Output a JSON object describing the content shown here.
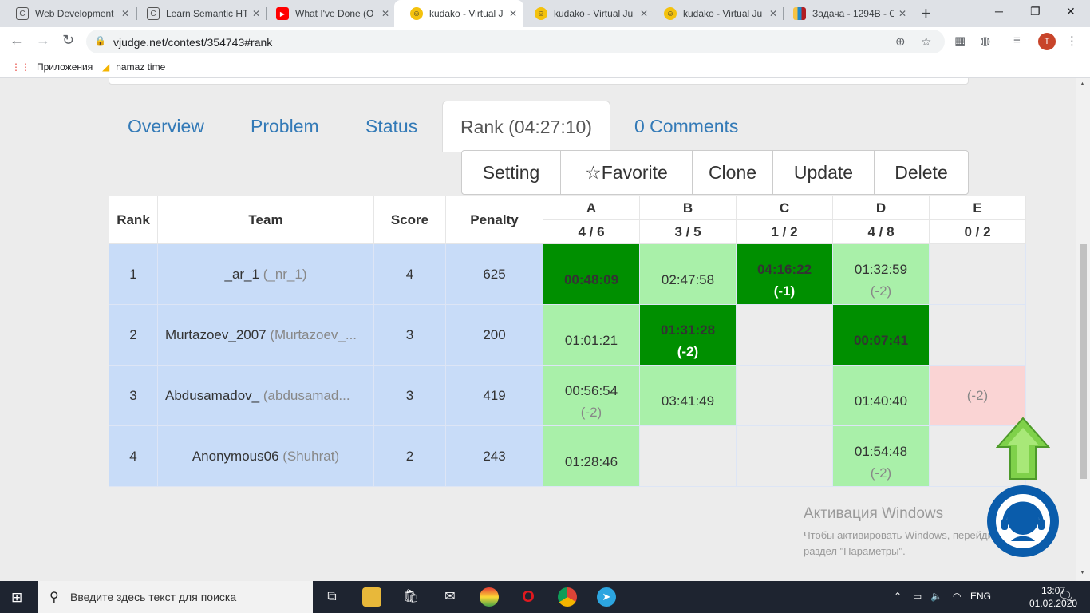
{
  "browser": {
    "tabs": [
      {
        "title": "Web Development",
        "icon": "c-icon",
        "active": false
      },
      {
        "title": "Learn Semantic HT",
        "icon": "c-icon",
        "active": false
      },
      {
        "title": "What I've Done (O",
        "icon": "youtube-icon",
        "active": false
      },
      {
        "title": "kudako - Virtual Ju",
        "icon": "vjudge-icon",
        "active": true
      },
      {
        "title": "kudako - Virtual Ju",
        "icon": "vjudge-icon",
        "active": false
      },
      {
        "title": "kudako - Virtual Ju",
        "icon": "vjudge-icon",
        "active": false
      },
      {
        "title": "Задача - 1294B - C",
        "icon": "codeforces-icon",
        "active": false
      }
    ],
    "url": "vjudge.net/contest/354743#rank",
    "avatar_letter": "T",
    "bookmarks": [
      {
        "label": "Приложения",
        "icon": "apps-grid-icon"
      },
      {
        "label": "namaz time",
        "icon": "drive-icon"
      }
    ]
  },
  "contest": {
    "nav_tabs": [
      {
        "label": "Overview",
        "active": false
      },
      {
        "label": "Problem",
        "active": false
      },
      {
        "label": "Status",
        "active": false
      },
      {
        "label": "Rank (04:27:10)",
        "active": true
      },
      {
        "label": "0 Comments",
        "active": false
      }
    ],
    "actions": {
      "setting": "Setting",
      "favorite": "☆Favorite",
      "clone": "Clone",
      "update": "Update",
      "delete": "Delete"
    },
    "rank_table": {
      "headers": {
        "rank": "Rank",
        "team": "Team",
        "score": "Score",
        "penalty": "Penalty"
      },
      "problems": [
        {
          "letter": "A",
          "ratio": "4 / 6"
        },
        {
          "letter": "B",
          "ratio": "3 / 5"
        },
        {
          "letter": "C",
          "ratio": "1 / 2"
        },
        {
          "letter": "D",
          "ratio": "4 / 8"
        },
        {
          "letter": "E",
          "ratio": "0 / 2"
        }
      ],
      "rows": [
        {
          "rank": "1",
          "team": "_ar_1",
          "nick": "(_nr_1)",
          "align": "center",
          "score": "4",
          "penalty": "625",
          "cells": [
            {
              "state": "first",
              "time": "00:48:09",
              "extra": ""
            },
            {
              "state": "ok",
              "time": "02:47:58",
              "extra": ""
            },
            {
              "state": "first",
              "time": "04:16:22",
              "extra": "(-1)"
            },
            {
              "state": "ok",
              "time": "01:32:59",
              "extra": "(-2)"
            },
            {
              "state": "empty",
              "time": "",
              "extra": ""
            }
          ]
        },
        {
          "rank": "2",
          "team": "Murtazoev_2007",
          "nick": "(Murtazoev_...",
          "align": "left",
          "score": "3",
          "penalty": "200",
          "cells": [
            {
              "state": "ok",
              "time": "01:01:21",
              "extra": ""
            },
            {
              "state": "first",
              "time": "01:31:28",
              "extra": "(-2)"
            },
            {
              "state": "empty",
              "time": "",
              "extra": ""
            },
            {
              "state": "first",
              "time": "00:07:41",
              "extra": ""
            },
            {
              "state": "empty",
              "time": "",
              "extra": ""
            }
          ]
        },
        {
          "rank": "3",
          "team": "Abdusamadov_",
          "nick": "(abdusamad...",
          "align": "left",
          "score": "3",
          "penalty": "419",
          "cells": [
            {
              "state": "ok",
              "time": "00:56:54",
              "extra": "(-2)"
            },
            {
              "state": "ok",
              "time": "03:41:49",
              "extra": ""
            },
            {
              "state": "empty",
              "time": "",
              "extra": ""
            },
            {
              "state": "ok",
              "time": "01:40:40",
              "extra": ""
            },
            {
              "state": "fail",
              "time": "",
              "extra": "(-2)"
            }
          ]
        },
        {
          "rank": "4",
          "team": "Anonymous06",
          "nick": "(Shuhrat)",
          "align": "center",
          "score": "2",
          "penalty": "243",
          "cells": [
            {
              "state": "ok",
              "time": "01:28:46",
              "extra": ""
            },
            {
              "state": "empty",
              "time": "",
              "extra": ""
            },
            {
              "state": "empty",
              "time": "",
              "extra": ""
            },
            {
              "state": "ok",
              "time": "01:54:48",
              "extra": "(-2)"
            },
            {
              "state": "empty",
              "time": "",
              "extra": ""
            }
          ]
        }
      ]
    }
  },
  "watermark": {
    "title": "Активация Windows",
    "line1": "Чтобы активировать Windows, перейдите в",
    "line2": "раздел \"Параметры\"."
  },
  "taskbar": {
    "search_placeholder": "Введите здесь текст для поиска",
    "lang": "ENG",
    "time": "13:07",
    "date": "01.02.2020",
    "notifications": "4"
  },
  "colors": {
    "link": "#337ab7",
    "first_solve": "#008f00",
    "accepted": "#a9f0a9",
    "failed": "#fad4d4",
    "team_info": "#c8dcf8"
  }
}
